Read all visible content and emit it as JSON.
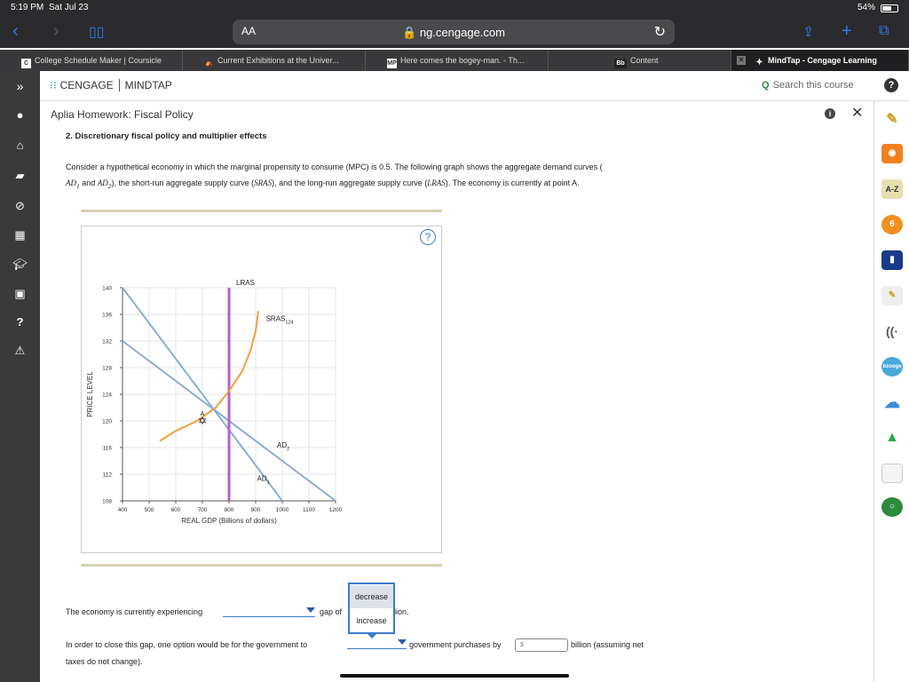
{
  "status_bar": {
    "time": "5:19 PM",
    "date": "Sat Jul 23",
    "battery": "54%"
  },
  "browser": {
    "aa_label": "AA",
    "url": "ng.cengage.com",
    "tabs": [
      {
        "favicon": "C",
        "label": "College Schedule Maker | Coursicle"
      },
      {
        "favicon": "⛺",
        "label": "Current Exhibitions at the Univer..."
      },
      {
        "favicon": "MP",
        "label": "Here comes the bogey-man. - Th..."
      },
      {
        "favicon": "Bb",
        "label": "Content"
      },
      {
        "favicon": "✦",
        "label": "MindTap - Cengage Learning"
      }
    ],
    "tab_close": "✕"
  },
  "mindtap": {
    "collapse": "»",
    "brand_left": "CENGAGE",
    "brand_right": "MINDTAP",
    "search_placeholder": "Search this course",
    "help": "?"
  },
  "homework": {
    "title": "Aplia Homework: Fiscal Policy",
    "info": "i",
    "close": "✕",
    "question_title": "2. Discretionary fiscal policy and multiplier effects",
    "q_text_1": "Consider a hypothetical economy in which the marginal propensity to consume (MPC) is 0.5. The following graph shows the aggregate demand curves (",
    "ad1": "AD",
    "ad1_sub": "1",
    "and": " and ",
    "ad2": "AD",
    "ad2_sub": "2",
    "q_text_2": "), the short-run aggregate supply curve (",
    "sras": "SRAS",
    "q_text_3": "), and the long-run aggregate supply curve (",
    "lras": "LRAS",
    "q_text_4": "). The economy is currently at point A.",
    "graph_help": "?",
    "line1_a": "The economy is currently experiencing",
    "line1_b": "gap of",
    "line1_c": "lion.",
    "line2_a": "In order to close this gap, one option would be for the government to",
    "line2_b": "government purchases by",
    "line2_c": "billion (assuming net",
    "line3": "taxes do not change).",
    "amount_placeholder": "$",
    "dropdown_options": [
      "decrease",
      "increase"
    ]
  },
  "chart_data": {
    "type": "line",
    "xlabel": "REAL GDP (Billions of dollars)",
    "ylabel": "PRICE LEVEL",
    "xlim": [
      400,
      1200
    ],
    "ylim": [
      108,
      140
    ],
    "x_ticks": [
      400,
      500,
      600,
      700,
      800,
      900,
      1000,
      1100,
      1200
    ],
    "y_ticks": [
      108,
      112,
      116,
      120,
      124,
      128,
      132,
      136,
      140
    ],
    "grid": true,
    "series": [
      {
        "name": "AD1",
        "label": "AD",
        "sub": "1",
        "color": "#8aaed0",
        "points": [
          [
            400,
            140
          ],
          [
            1000,
            108
          ]
        ]
      },
      {
        "name": "AD2",
        "label": "AD",
        "sub": "2",
        "color": "#8aaed0",
        "points": [
          [
            400,
            132
          ],
          [
            1200,
            108
          ]
        ]
      },
      {
        "name": "LRAS",
        "label": "LRAS",
        "sub": "",
        "color": "#b45fcf",
        "points": [
          [
            800,
            108
          ],
          [
            800,
            140
          ]
        ]
      },
      {
        "name": "SRAS",
        "label": "SRAS",
        "sub": "124",
        "color": "#f0a040",
        "points": [
          [
            540,
            117
          ],
          [
            600,
            118.5
          ],
          [
            680,
            120
          ],
          [
            750,
            122
          ],
          [
            800,
            124.5
          ],
          [
            850,
            127.5
          ],
          [
            880,
            130.5
          ],
          [
            900,
            133.5
          ],
          [
            910,
            136.5
          ]
        ]
      }
    ],
    "points": [
      {
        "label": "A",
        "x": 700,
        "y": 120
      }
    ]
  }
}
